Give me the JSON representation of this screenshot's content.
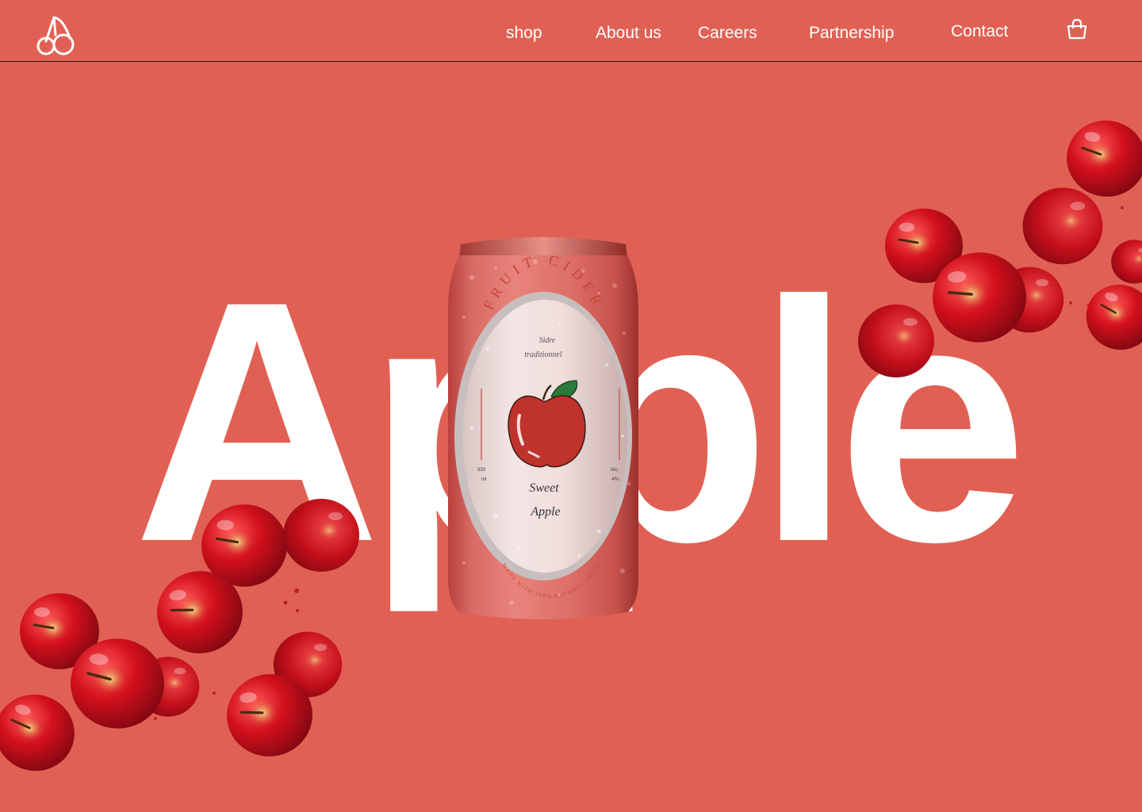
{
  "nav": {
    "items": [
      {
        "label": "shop"
      },
      {
        "label": "About us"
      },
      {
        "label": "Careers"
      },
      {
        "label": "Partnership"
      },
      {
        "label": "Contact"
      }
    ]
  },
  "icons": {
    "logo": "cherry-logo-icon",
    "cart": "shopping-bag-icon"
  },
  "hero": {
    "word": "Apple"
  },
  "can_label": {
    "arc_top": "FRUIT CIDER",
    "subtitle_line1": "Sidre",
    "subtitle_line2": "traditionnel",
    "volume_value": "330",
    "volume_unit": "ml",
    "alc_label": "Alc.",
    "alc_value": "4%",
    "name_line1": "Sweet",
    "name_line2": "Apple",
    "arc_bottom": "MADE WITH 100% NATURAL FRUIT"
  },
  "colors": {
    "background": "#e06154",
    "text": "#ffffff",
    "header_border": "#2a1512",
    "apple_red": "#c8141c"
  }
}
